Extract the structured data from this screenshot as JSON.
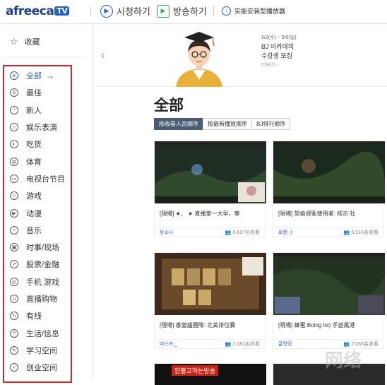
{
  "header": {
    "logo_text": "afreeca",
    "logo_tv": "TV",
    "watch_label": "시청하기",
    "broadcast_label": "방송하기",
    "install_label": "实能安装型播放器"
  },
  "sidebar": {
    "favorites_label": "收藏",
    "active_arrow": "→",
    "items": [
      {
        "label": "全部",
        "icon": "all-icon"
      },
      {
        "label": "最佳",
        "icon": "medal-icon"
      },
      {
        "label": "新人",
        "icon": "newbie-icon"
      },
      {
        "label": "娱乐表演",
        "icon": "smile-icon"
      },
      {
        "label": "吃货",
        "icon": "food-icon"
      },
      {
        "label": "体育",
        "icon": "sports-icon"
      },
      {
        "label": "电视台节目",
        "icon": "tv-icon"
      },
      {
        "label": "游戏",
        "icon": "gamepad-icon"
      },
      {
        "label": "动漫",
        "icon": "play-icon"
      },
      {
        "label": "音乐",
        "icon": "music-icon"
      },
      {
        "label": "时事/现场",
        "icon": "camera-icon"
      },
      {
        "label": "股票/金融",
        "icon": "chart-icon"
      },
      {
        "label": "手机 游戏",
        "icon": "mobile-game-icon"
      },
      {
        "label": "直播购物",
        "icon": "cart-icon"
      },
      {
        "label": "有线",
        "icon": "cable-icon"
      },
      {
        "label": "生活/信息",
        "icon": "info-icon"
      },
      {
        "label": "学习空间",
        "icon": "pen-icon"
      },
      {
        "label": "创业空间",
        "icon": "rocket-icon"
      }
    ]
  },
  "banner": {
    "date": "9/2(수) ~ 9/6(일)",
    "title_line1": "BJ 아카데미",
    "title_line2": "수강생 모집",
    "more": "더보기 ›"
  },
  "main": {
    "title": "全部",
    "tabs": [
      "按收看人员顺序",
      "按最新播放顺序",
      "BJ排行顺序"
    ]
  },
  "cards": [
    {
      "title": "[現場] ★、 ★ 直播室一大早，尊",
      "user": "뮤소나",
      "viewers": "6,687名收看"
    },
    {
      "title": "[現場] 努偷資衛使用者: 核示:社",
      "user": "로렌:-)",
      "viewers": "5,516名收看"
    },
    {
      "title": "[現場] 香蠻爐團隊: 北美排位賽",
      "user": "마스카:_ ",
      "viewers": "2,382名收看"
    },
    {
      "title": "[現場] 蜂蜜 Boing lol) 手遊風港",
      "user": "꿀멍멍",
      "viewers": "2,063名收看"
    },
    {
      "overlay": "얍뿔고하는방송"
    }
  ],
  "watermark": "网络"
}
